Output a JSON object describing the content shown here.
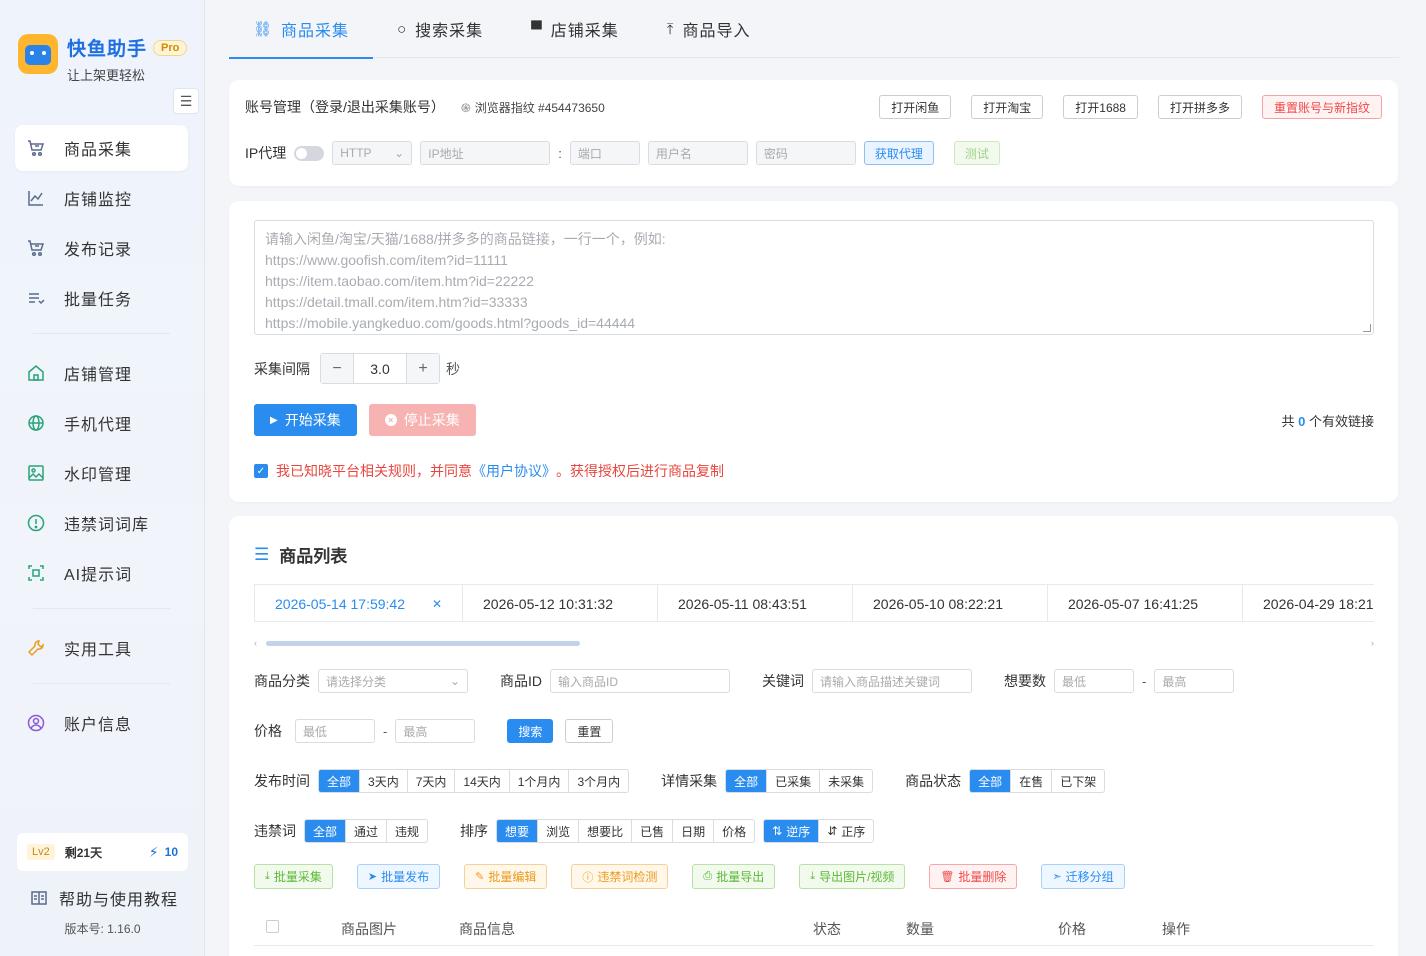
{
  "brand": {
    "name": "快鱼助手",
    "badge": "Pro",
    "slogan": "让上架更轻松"
  },
  "icons": {
    "collapse": "menu-fold-icon",
    "accent": "#2b8cf0"
  },
  "sidebar": {
    "groups": [
      [
        {
          "label": "商品采集",
          "icon": "cart-icon",
          "active": true
        },
        {
          "label": "店铺监控",
          "icon": "line-chart-icon"
        },
        {
          "label": "发布记录",
          "icon": "cart-icon"
        },
        {
          "label": "批量任务",
          "icon": "list-icon"
        }
      ],
      [
        {
          "label": "店铺管理",
          "icon": "home-icon"
        },
        {
          "label": "手机代理",
          "icon": "globe-icon"
        },
        {
          "label": "水印管理",
          "icon": "image-icon"
        },
        {
          "label": "违禁词词库",
          "icon": "alert-circle-icon"
        },
        {
          "label": "AI提示词",
          "icon": "scan-icon"
        }
      ],
      [
        {
          "label": "实用工具",
          "icon": "tool-icon"
        }
      ],
      [
        {
          "label": "账户信息",
          "icon": "user-circle-icon"
        }
      ]
    ],
    "level": {
      "badge": "Lv2",
      "days": "剩21天",
      "points": "10"
    },
    "help": "帮助与使用教程",
    "version": "版本号: 1.16.0"
  },
  "tabs": [
    {
      "label": "商品采集",
      "icon": "link-icon",
      "glyph": "⛓",
      "active": true
    },
    {
      "label": "搜索采集",
      "icon": "search-icon",
      "glyph": "○"
    },
    {
      "label": "店铺采集",
      "icon": "store-icon",
      "glyph": "▀"
    },
    {
      "label": "商品导入",
      "icon": "upload-icon",
      "glyph": "⤒"
    }
  ],
  "account": {
    "title": "账号管理（登录/退出采集账号）",
    "fingerprint": "浏览器指纹 #454473650",
    "buttons": [
      "打开闲鱼",
      "打开淘宝",
      "打开1688",
      "打开拼多多"
    ],
    "reset_button": "重置账号与新指纹",
    "ip_label": "IP代理",
    "protocol": "HTTP",
    "ip_placeholder": "IP地址",
    "port_placeholder": "端口",
    "user_placeholder": "用户名",
    "pass_placeholder": "密码",
    "get_proxy": "获取代理",
    "test": "测试"
  },
  "collect": {
    "placeholder_lines": [
      "请输入闲鱼/淘宝/天猫/1688/拼多多的商品链接，一行一个，例如:",
      "https://www.goofish.com/item?id=11111",
      "https://item.taobao.com/item.htm?id=22222",
      "https://detail.tmall.com/item.htm?id=33333",
      "https://mobile.yangkeduo.com/goods.html?goods_id=44444"
    ],
    "interval_label": "采集间隔",
    "interval_value": "3.0",
    "interval_unit": "秒",
    "start": "开始采集",
    "stop": "停止采集",
    "count_prefix": "共",
    "count": "0",
    "count_suffix": "个有效链接",
    "agree_text": "我已知晓平台相关规则，并同意",
    "agree_link": "《用户协议》",
    "agree_tail": "。获得授权后进行商品复制"
  },
  "list": {
    "title": "商品列表",
    "dates": [
      "2026-05-14 17:59:42",
      "2026-05-12 10:31:32",
      "2026-05-11 08:43:51",
      "2026-05-10 08:22:21",
      "2026-05-07 16:41:25",
      "2026-04-29 18:21:"
    ],
    "filters": {
      "category_label": "商品分类",
      "category_placeholder": "请选择分类",
      "id_label": "商品ID",
      "id_placeholder": "输入商品ID",
      "keyword_label": "关键词",
      "keyword_placeholder": "请输入商品描述关键词",
      "want_label": "想要数",
      "min": "最低",
      "max": "最高",
      "price_label": "价格",
      "search": "搜索",
      "reset": "重置",
      "time_label": "发布时间",
      "time_options": [
        "全部",
        "3天内",
        "7天内",
        "14天内",
        "1个月内",
        "3个月内"
      ],
      "detail_label": "详情采集",
      "detail_options": [
        "全部",
        "已采集",
        "未采集"
      ],
      "status_label": "商品状态",
      "status_options": [
        "全部",
        "在售",
        "已下架"
      ],
      "banned_label": "违禁词",
      "banned_options": [
        "全部",
        "通过",
        "违规"
      ],
      "sort_label": "排序",
      "sort_options": [
        "想要",
        "浏览",
        "想要比",
        "已售",
        "日期",
        "价格"
      ],
      "order_options": [
        "逆序",
        "正序"
      ]
    },
    "batch": [
      {
        "label": "批量采集",
        "glyph": "⤓",
        "icon": "download-icon",
        "color": "green"
      },
      {
        "label": "批量发布",
        "glyph": "➤",
        "icon": "send-icon",
        "color": "blue"
      },
      {
        "label": "批量编辑",
        "glyph": "✎",
        "icon": "edit-icon",
        "color": "orange"
      },
      {
        "label": "违禁词检测",
        "glyph": "ⓘ",
        "icon": "warning-icon",
        "color": "orange"
      },
      {
        "label": "批量导出",
        "glyph": "⎙",
        "icon": "print-icon",
        "color": "green"
      },
      {
        "label": "导出图片/视频",
        "glyph": "⤓",
        "icon": "download-icon",
        "color": "green"
      },
      {
        "label": "批量删除",
        "glyph": "🗑",
        "icon": "trash-icon",
        "color": "red"
      },
      {
        "label": "迁移分组",
        "glyph": "➣",
        "icon": "send-icon",
        "color": "blue"
      }
    ],
    "columns": [
      "商品图片",
      "商品信息",
      "状态",
      "数量",
      "价格",
      "操作"
    ]
  }
}
